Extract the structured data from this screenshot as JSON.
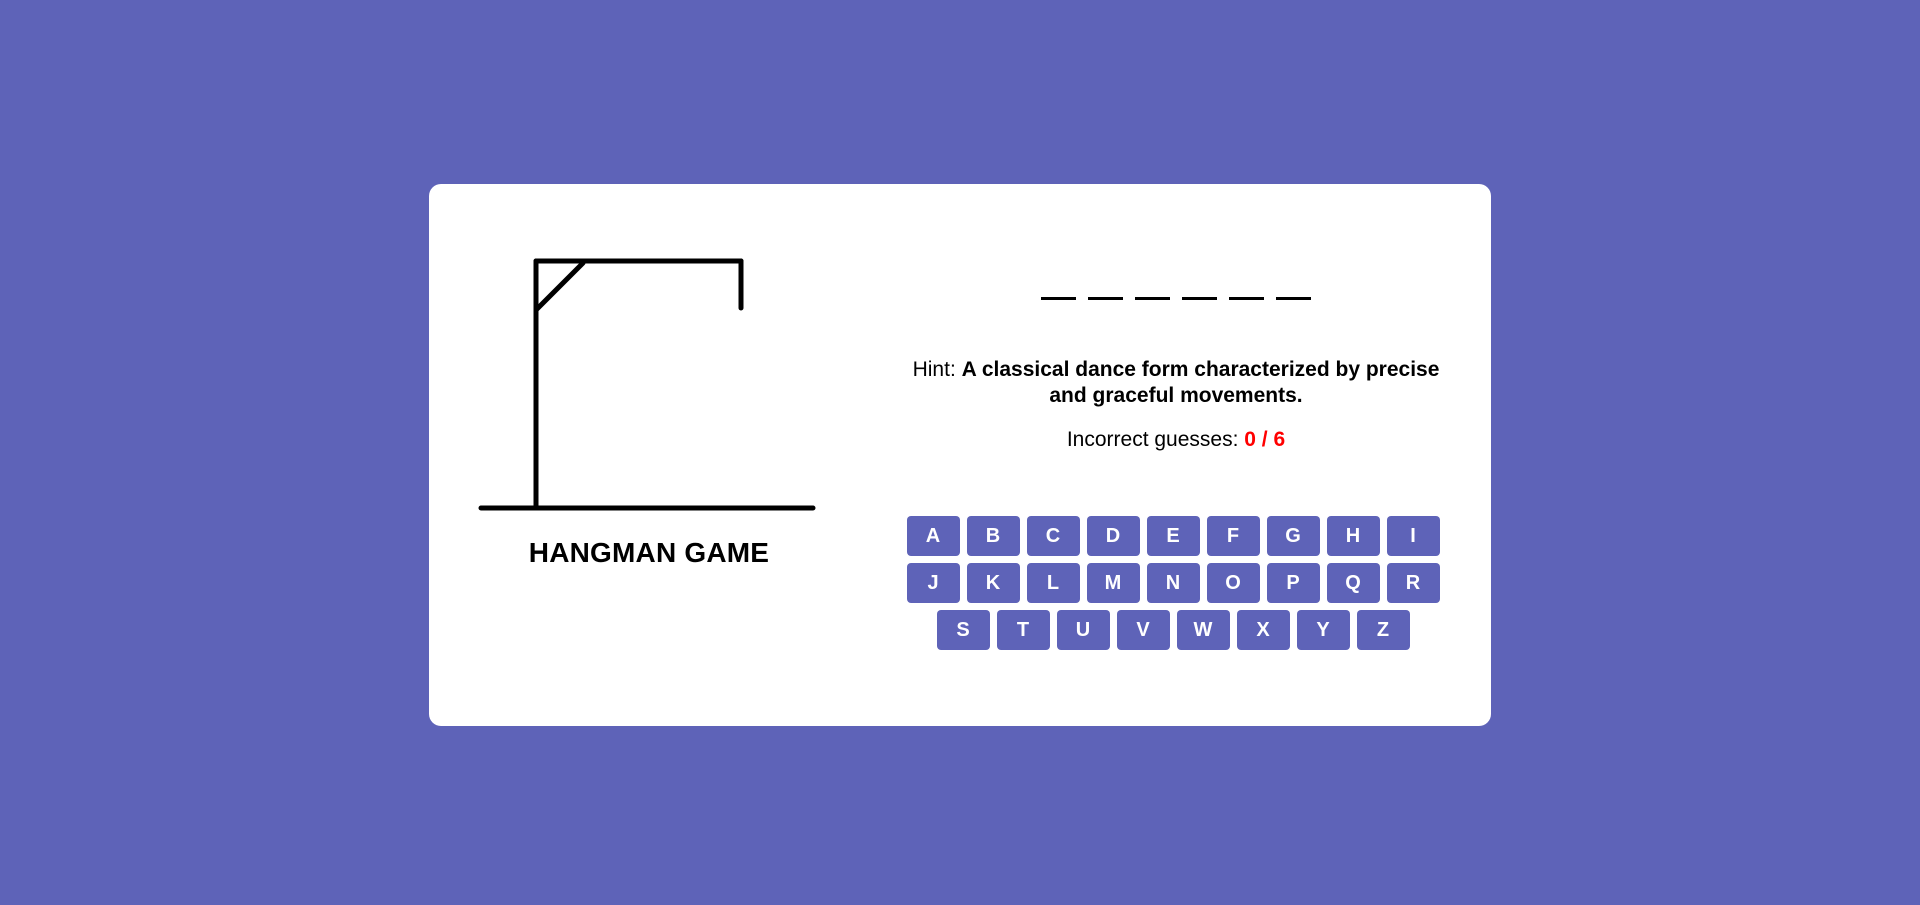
{
  "game": {
    "title": "HANGMAN GAME",
    "word_length": 6,
    "hint_label": "Hint: ",
    "hint_text": "A classical dance form characterized by precise and graceful movements.",
    "incorrect_label": "Incorrect guesses: ",
    "incorrect_count": "0 / 6"
  },
  "keyboard": {
    "keys": [
      "A",
      "B",
      "C",
      "D",
      "E",
      "F",
      "G",
      "H",
      "I",
      "J",
      "K",
      "L",
      "M",
      "N",
      "O",
      "P",
      "Q",
      "R",
      "S",
      "T",
      "U",
      "V",
      "W",
      "X",
      "Y",
      "Z"
    ]
  },
  "colors": {
    "background": "#5e63b8",
    "card": "#ffffff",
    "key": "#5e63b8",
    "key_text": "#ffffff",
    "guess_count": "#ff0000"
  },
  "icons": {
    "gallows": "gallows-drawing"
  }
}
